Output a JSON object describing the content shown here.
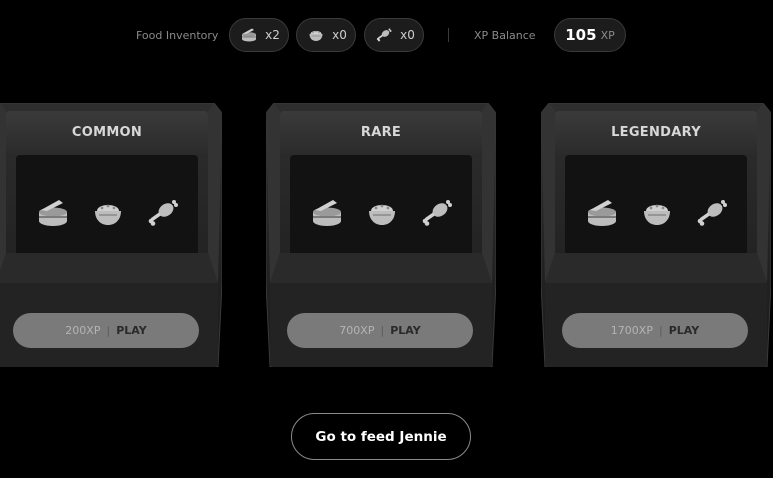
{
  "header": {
    "inventory_label": "Food Inventory",
    "items": [
      {
        "icon": "food-can-icon",
        "count": "x2"
      },
      {
        "icon": "rice-bowl-icon",
        "count": "x0"
      },
      {
        "icon": "meat-bone-icon",
        "count": "x0"
      }
    ],
    "xp_label": "XP Balance",
    "xp_value": "105",
    "xp_unit": "XP"
  },
  "machines": [
    {
      "title": "COMMON",
      "cost": "200XP",
      "separator": "|",
      "action": "PLAY"
    },
    {
      "title": "RARE",
      "cost": "700XP",
      "separator": "|",
      "action": "PLAY"
    },
    {
      "title": "LEGENDARY",
      "cost": "1700XP",
      "separator": "|",
      "action": "PLAY"
    }
  ],
  "feed_button": "Go to feed Jennie",
  "colors": {
    "background": "#000000",
    "machine_body": "#262626",
    "machine_screen": "#141414",
    "play_button": "#7a7a7a",
    "food_icon": "#bdbdbd"
  }
}
